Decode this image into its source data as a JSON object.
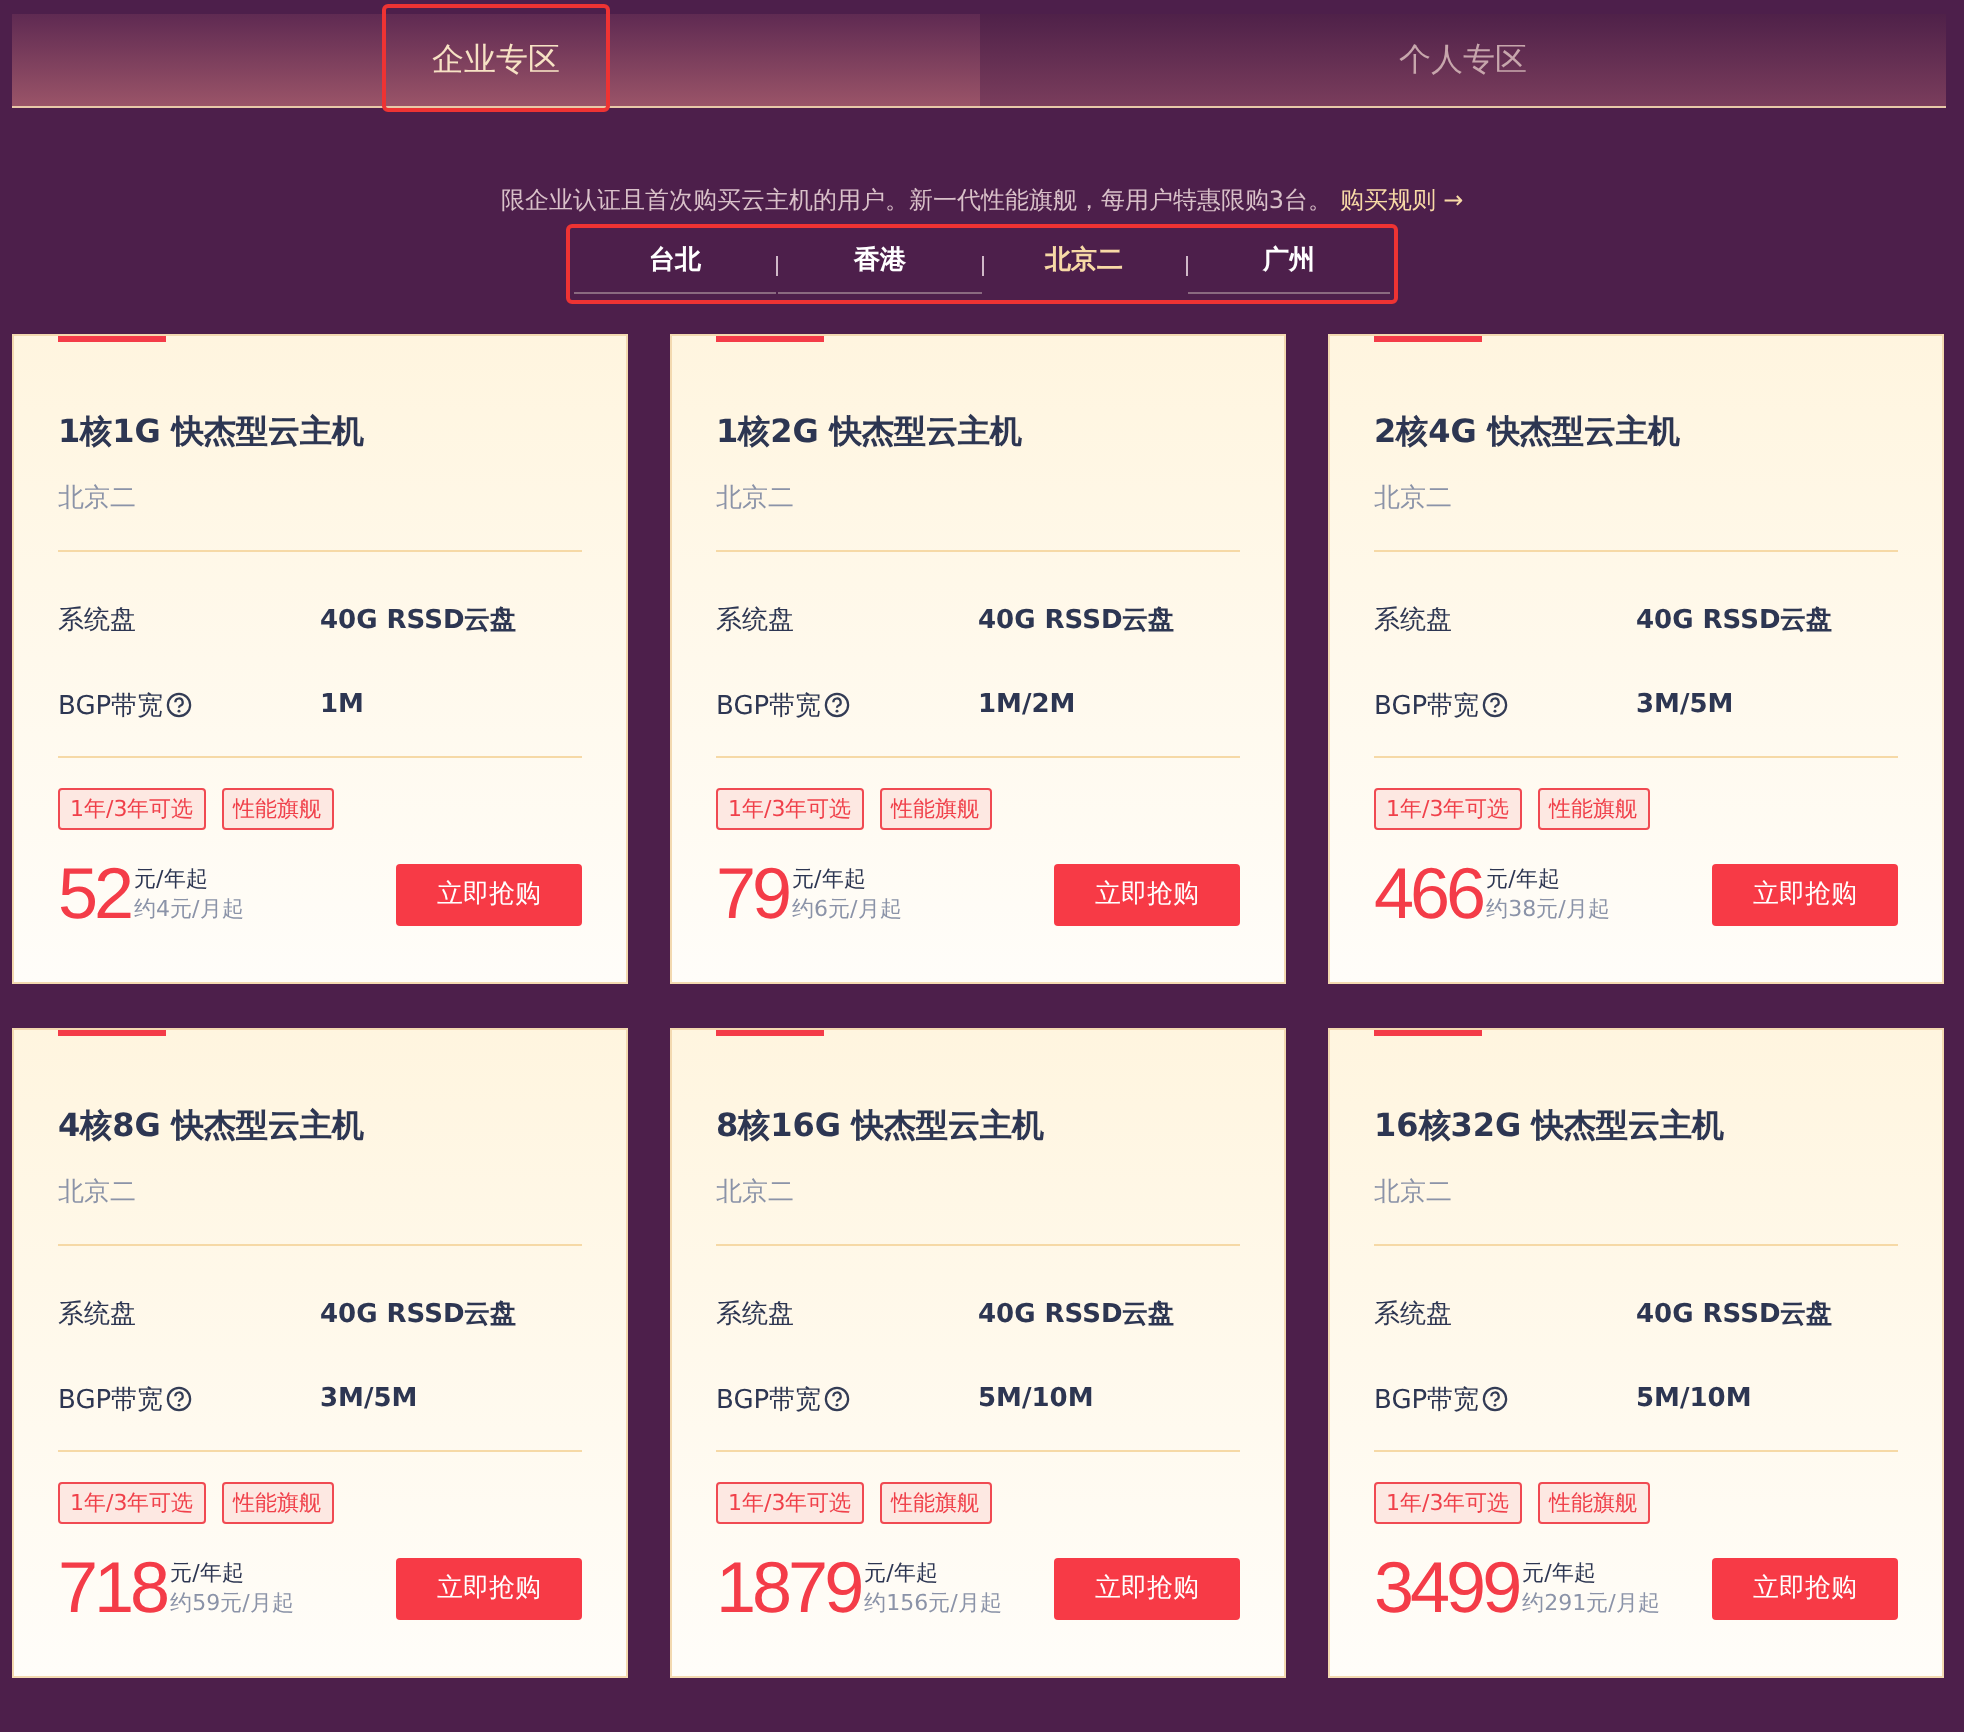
{
  "zone_tabs": [
    {
      "label": "企业专区",
      "selected": true
    },
    {
      "label": "个人专区",
      "selected": false
    }
  ],
  "notice": {
    "text": "限企业认证且首次购买云主机的用户。新一代性能旗舰，每用户特惠限购3台。",
    "link": "购买规则",
    "arrow": "→"
  },
  "regions": [
    {
      "label": "台北",
      "selected": false
    },
    {
      "label": "香港",
      "selected": false
    },
    {
      "label": "北京二",
      "selected": true
    },
    {
      "label": "广州",
      "selected": false
    }
  ],
  "products": [
    {
      "title": "1核1G 快杰型云主机",
      "location": "北京二",
      "specs": [
        {
          "label": "系统盘",
          "value": "40G RSSD云盘",
          "help": false
        },
        {
          "label": "BGP带宽",
          "value": "1M",
          "help": true
        }
      ],
      "tags": [
        "1年/3年可选",
        "性能旗舰"
      ],
      "price": "52",
      "unit": "元/年起",
      "monthly": "约4元/月起",
      "button": "立即抢购"
    },
    {
      "title": "1核2G 快杰型云主机",
      "location": "北京二",
      "specs": [
        {
          "label": "系统盘",
          "value": "40G RSSD云盘",
          "help": false
        },
        {
          "label": "BGP带宽",
          "value": "1M/2M",
          "help": true
        }
      ],
      "tags": [
        "1年/3年可选",
        "性能旗舰"
      ],
      "price": "79",
      "unit": "元/年起",
      "monthly": "约6元/月起",
      "button": "立即抢购"
    },
    {
      "title": "2核4G 快杰型云主机",
      "location": "北京二",
      "specs": [
        {
          "label": "系统盘",
          "value": "40G RSSD云盘",
          "help": false
        },
        {
          "label": "BGP带宽",
          "value": "3M/5M",
          "help": true
        }
      ],
      "tags": [
        "1年/3年可选",
        "性能旗舰"
      ],
      "price": "466",
      "unit": "元/年起",
      "monthly": "约38元/月起",
      "button": "立即抢购"
    },
    {
      "title": "4核8G 快杰型云主机",
      "location": "北京二",
      "specs": [
        {
          "label": "系统盘",
          "value": "40G RSSD云盘",
          "help": false
        },
        {
          "label": "BGP带宽",
          "value": "3M/5M",
          "help": true
        }
      ],
      "tags": [
        "1年/3年可选",
        "性能旗舰"
      ],
      "price": "718",
      "unit": "元/年起",
      "monthly": "约59元/月起",
      "button": "立即抢购"
    },
    {
      "title": "8核16G 快杰型云主机",
      "location": "北京二",
      "specs": [
        {
          "label": "系统盘",
          "value": "40G RSSD云盘",
          "help": false
        },
        {
          "label": "BGP带宽",
          "value": "5M/10M",
          "help": true
        }
      ],
      "tags": [
        "1年/3年可选",
        "性能旗舰"
      ],
      "price": "1879",
      "unit": "元/年起",
      "monthly": "约156元/月起",
      "button": "立即抢购"
    },
    {
      "title": "16核32G 快杰型云主机",
      "location": "北京二",
      "specs": [
        {
          "label": "系统盘",
          "value": "40G RSSD云盘",
          "help": false
        },
        {
          "label": "BGP带宽",
          "value": "5M/10M",
          "help": true
        }
      ],
      "tags": [
        "1年/3年可选",
        "性能旗舰"
      ],
      "price": "3499",
      "unit": "元/年起",
      "monthly": "约291元/月起",
      "button": "立即抢购"
    }
  ]
}
